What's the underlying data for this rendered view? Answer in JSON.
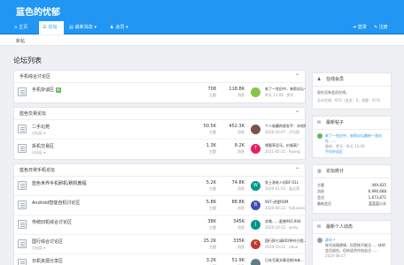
{
  "site": {
    "title": "蓝色的忧郁"
  },
  "nav": {
    "items": [
      {
        "label": "主页",
        "icon": "home-icon"
      },
      {
        "label": "论坛",
        "icon": "comments-icon"
      },
      {
        "label": "最新消息",
        "icon": "news-icon"
      },
      {
        "label": "会员",
        "icon": "users-icon"
      }
    ],
    "login": "登录",
    "register": "注册"
  },
  "subbar": {
    "crumb": "新帖"
  },
  "page": {
    "title": "论坛列表"
  },
  "labels": {
    "topics": "主题",
    "posts": "消息"
  },
  "sections": [
    {
      "title": "手机综合讨论区",
      "rows": [
        {
          "name": "手机杂谈区",
          "badge": "新",
          "sub": "",
          "topics": "708",
          "posts": "118.8K",
          "avatar": "",
          "avatar_color": "#8bc34a",
          "last_title": "老了一些旧中，来帮论坛一…",
          "last_meta": "昨天 11:06 · 梦天"
        }
      ]
    },
    {
      "title": "蓝色交易论坛",
      "rows": [
        {
          "name": "二手北苑",
          "badge": "",
          "sub": "讨论区 ▾",
          "topics": "50.5K",
          "posts": "452.3K",
          "avatar": "",
          "avatar_color": "#795548",
          "last_title": "个人收藏的收发手：本地购…",
          "last_meta": "2020-10-07 · 河马鱼"
        },
        {
          "name": "拆机交易区",
          "badge": "",
          "sub": "讨论区 ▾",
          "topics": "1.3K",
          "posts": "8.2K",
          "avatar": "T",
          "avatar_color": "#e91e63",
          "last_title": "想要草泥马，价格高？",
          "last_meta": "2021-05-21 · 9yang"
        }
      ]
    },
    {
      "title": "蓝色日常手机论坛",
      "rows": [
        {
          "name": "蓝色世界手机刷机/刷机教程",
          "badge": "",
          "sub": "",
          "topics": "5.2K",
          "posts": "74.8K",
          "avatar": "W",
          "avatar_color": "#009688",
          "last_title": "发士源老人机BF-01L",
          "last_meta": "2020-01-02 · 梨达哥"
        },
        {
          "name": "Android智能自机讨论区",
          "badge": "",
          "sub": "",
          "topics": "5.8K",
          "posts": "88.8K",
          "avatar": "B",
          "avatar_color": "#3f51b5",
          "last_title": "907-进程ROM",
          "last_meta": "2020-09-22 · fyduesse"
        },
        {
          "name": "传统旧机综合讨论区",
          "badge": "",
          "sub": "",
          "topics": "38K",
          "posts": "345K",
          "avatar": "J",
          "avatar_color": "#009688",
          "last_title": "求救……夏普903.904",
          "last_meta": "2020-10-12 · wiely"
        },
        {
          "name": "国行综合讨论区",
          "badge": "",
          "sub": "讨论区 ▾",
          "topics": "25.2K",
          "posts": "335K",
          "avatar": "K",
          "avatar_color": "#c0392b",
          "last_title": "国行探七请K02种升归思…",
          "last_meta": "2020-10-22 · roluo"
        },
        {
          "name": "日机资源分享区",
          "badge": "",
          "sub": "",
          "topics": "3.2K",
          "posts": "51.9K",
          "avatar": "",
          "avatar_color": "#607d8b",
          "last_title": "日本写真文章北郎诗来…",
          "last_meta": ""
        }
      ]
    }
  ],
  "sidebar": {
    "online": {
      "title": "在线会员",
      "text": "现在没有会员在线。",
      "stats": "总计在线：873（会员：0，游客：873）"
    },
    "latest": {
      "title": "最新帖子",
      "post_title": "老了一些旧中，来帮论坛翻修一直存在……",
      "post_meta": "最新：梦天 · 昨天 11:06",
      "post_forum": "手机杂谈区"
    },
    "stats": {
      "title": "论坛统计",
      "rows": [
        {
          "label": "主题",
          "value": "449,835"
        },
        {
          "label": "消息",
          "value": "6,990,688"
        },
        {
          "label": "会员",
          "value": "1,673,871"
        },
        {
          "label": "最新会员",
          "value": "蓝蓝蓝小天"
        }
      ]
    },
    "status": {
      "title": "最新个人动态",
      "user": "谁吗 •",
      "text": "账号选随便情，但是帐不能注……帐转会员退在。但欢迎合作加去注……",
      "date": "2020-08-27"
    }
  }
}
